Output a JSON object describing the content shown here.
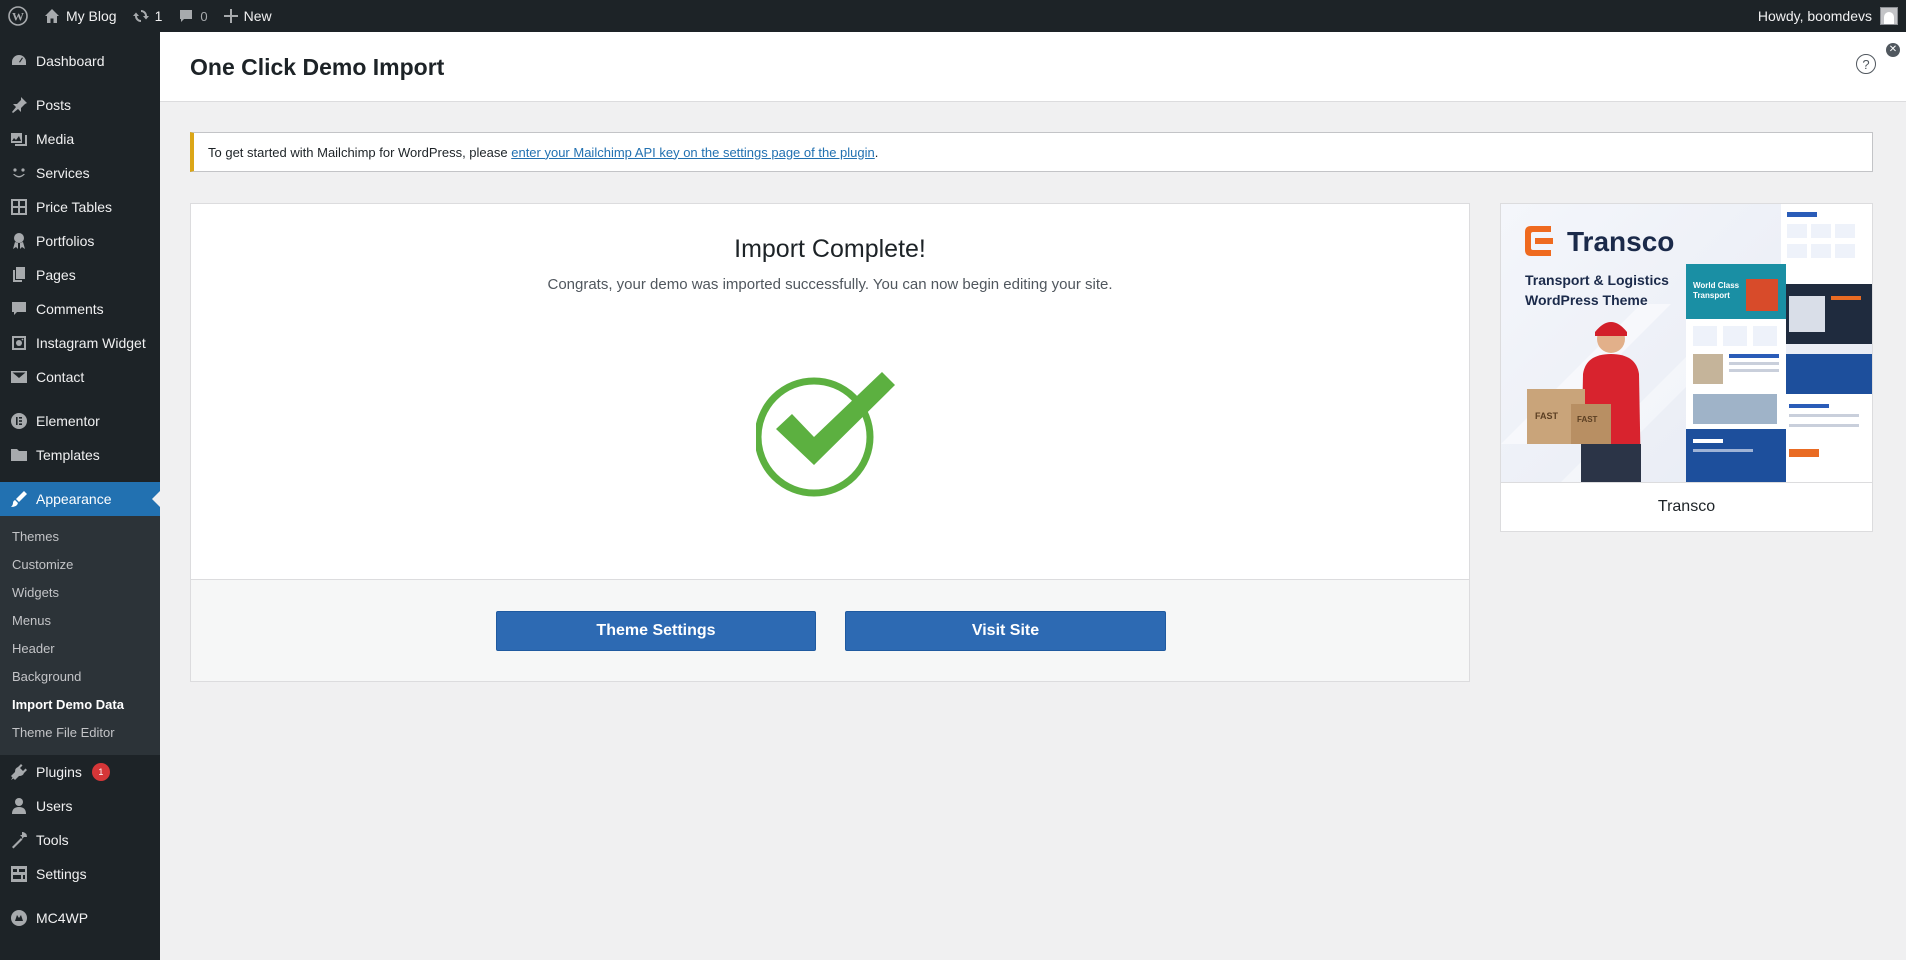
{
  "admin_bar": {
    "site_name": "My Blog",
    "updates_count": "1",
    "comments_count": "0",
    "new_label": "New",
    "greeting": "Howdy, boomdevs"
  },
  "sidebar": {
    "group1": [
      {
        "label": "Dashboard",
        "icon": "dashboard-icon"
      }
    ],
    "group2": [
      {
        "label": "Posts",
        "icon": "pin-icon"
      },
      {
        "label": "Media",
        "icon": "media-icon"
      },
      {
        "label": "Services",
        "icon": "smile-icon"
      },
      {
        "label": "Price Tables",
        "icon": "grid-icon"
      },
      {
        "label": "Portfolios",
        "icon": "award-icon"
      },
      {
        "label": "Pages",
        "icon": "pages-icon"
      },
      {
        "label": "Comments",
        "icon": "comment-icon"
      },
      {
        "label": "Instagram Widget",
        "icon": "instagram-icon"
      },
      {
        "label": "Contact",
        "icon": "mail-icon"
      }
    ],
    "group3": [
      {
        "label": "Elementor",
        "icon": "elementor-icon"
      },
      {
        "label": "Templates",
        "icon": "folder-icon"
      }
    ],
    "appearance": {
      "label": "Appearance",
      "icon": "brush-icon"
    },
    "appearance_sub": [
      "Themes",
      "Customize",
      "Widgets",
      "Menus",
      "Header",
      "Background",
      "Import Demo Data",
      "Theme File Editor"
    ],
    "group4": [
      {
        "label": "Plugins",
        "icon": "plugin-icon",
        "badge": "1"
      },
      {
        "label": "Users",
        "icon": "users-icon"
      },
      {
        "label": "Tools",
        "icon": "wrench-icon"
      },
      {
        "label": "Settings",
        "icon": "settings-icon"
      }
    ],
    "group5": [
      {
        "label": "MC4WP",
        "icon": "mc4wp-icon"
      }
    ]
  },
  "page": {
    "title": "One Click Demo Import",
    "help_icon": "?"
  },
  "notice": {
    "text": "To get started with Mailchimp for WordPress, please ",
    "link": "enter your Mailchimp API key on the settings page of the plugin",
    "suffix": "."
  },
  "import": {
    "title": "Import Complete!",
    "message": "Congrats, your demo was imported successfully. You can now begin editing your site.",
    "theme_settings_label": "Theme Settings",
    "visit_site_label": "Visit Site",
    "check_color": "#5cb040"
  },
  "theme_preview": {
    "logo_text": "Transco",
    "tagline": "Transport & Logistics WordPress Theme",
    "name": "Transco"
  },
  "colors": {
    "accent": "#2271b1",
    "button": "#2d6ab3",
    "notice_border": "#dba617",
    "badge": "#d63638"
  }
}
